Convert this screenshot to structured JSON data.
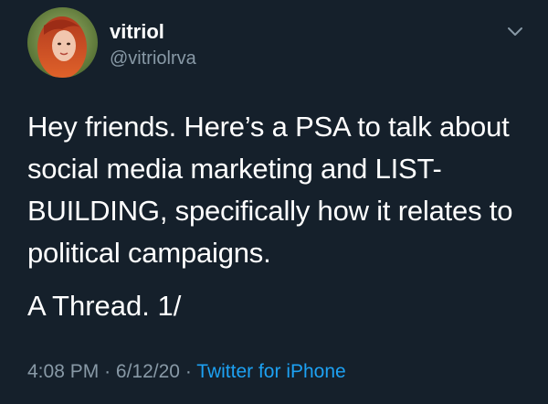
{
  "tweet": {
    "display_name": "vitriol",
    "handle": "@vitriolrva",
    "body": "Hey friends. Here’s a PSA to talk about social media marketing and LIST-BUILDING, specifically how it relates to political campaigns.",
    "thread_marker": "A Thread. 1/",
    "time": "4:08 PM",
    "separator": "·",
    "date": "6/12/20",
    "source": "Twitter for iPhone"
  },
  "icons": {
    "menu": "chevron-down-icon",
    "avatar": "profile-photo"
  },
  "colors": {
    "background": "#15202b",
    "text": "#ffffff",
    "muted": "#8899a6",
    "link": "#1da1f2"
  }
}
